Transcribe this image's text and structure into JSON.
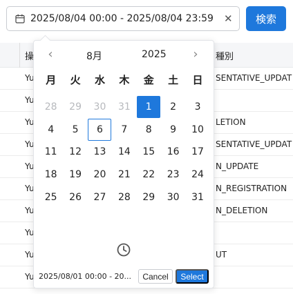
{
  "filter": {
    "range_value": "2025/08/04 00:00 - 2025/08/04 23:59",
    "search_label": "検索"
  },
  "table": {
    "headers": [
      "",
      "操",
      "種別"
    ],
    "rows": [
      {
        "user": "Yu",
        "type": "SENTATIVE_UPDAT"
      },
      {
        "user": "Yu",
        "type": ""
      },
      {
        "user": "Yu",
        "type": "LETION"
      },
      {
        "user": "Yu",
        "type": "SENTATIVE_UPDAT"
      },
      {
        "user": "Yu",
        "type": "N_UPDATE"
      },
      {
        "user": "Yu",
        "type": "N_REGISTRATION"
      },
      {
        "user": "Yu",
        "type": "N_DELETION"
      },
      {
        "user": "Yu",
        "type": ""
      },
      {
        "user": "Yu",
        "type": "UT"
      },
      {
        "user": "Yu",
        "type": ""
      }
    ]
  },
  "calendar": {
    "prev_icon": "‹",
    "next_icon": "›",
    "month": "8月",
    "year": "2025",
    "weekdays": [
      "月",
      "火",
      "水",
      "木",
      "金",
      "土",
      "日"
    ],
    "weeks": [
      [
        {
          "d": "28",
          "muted": true
        },
        {
          "d": "29",
          "muted": true
        },
        {
          "d": "30",
          "muted": true
        },
        {
          "d": "31",
          "muted": true
        },
        {
          "d": "1",
          "selected": true
        },
        {
          "d": "2"
        },
        {
          "d": "3"
        }
      ],
      [
        {
          "d": "4"
        },
        {
          "d": "5"
        },
        {
          "d": "6",
          "today": true
        },
        {
          "d": "7"
        },
        {
          "d": "8"
        },
        {
          "d": "9"
        },
        {
          "d": "10"
        }
      ],
      [
        {
          "d": "11"
        },
        {
          "d": "12"
        },
        {
          "d": "13"
        },
        {
          "d": "14"
        },
        {
          "d": "15"
        },
        {
          "d": "16"
        },
        {
          "d": "17"
        }
      ],
      [
        {
          "d": "18"
        },
        {
          "d": "19"
        },
        {
          "d": "20"
        },
        {
          "d": "21"
        },
        {
          "d": "22"
        },
        {
          "d": "23"
        },
        {
          "d": "24"
        }
      ],
      [
        {
          "d": "25"
        },
        {
          "d": "26"
        },
        {
          "d": "27"
        },
        {
          "d": "28"
        },
        {
          "d": "29"
        },
        {
          "d": "30"
        },
        {
          "d": "31"
        }
      ]
    ],
    "selection_summary": "2025/08/01 00:00 - 20...",
    "cancel_label": "Cancel",
    "select_label": "Select"
  },
  "colors": {
    "accent": "#1e78dc",
    "muted_day": "#b7b9bd"
  }
}
